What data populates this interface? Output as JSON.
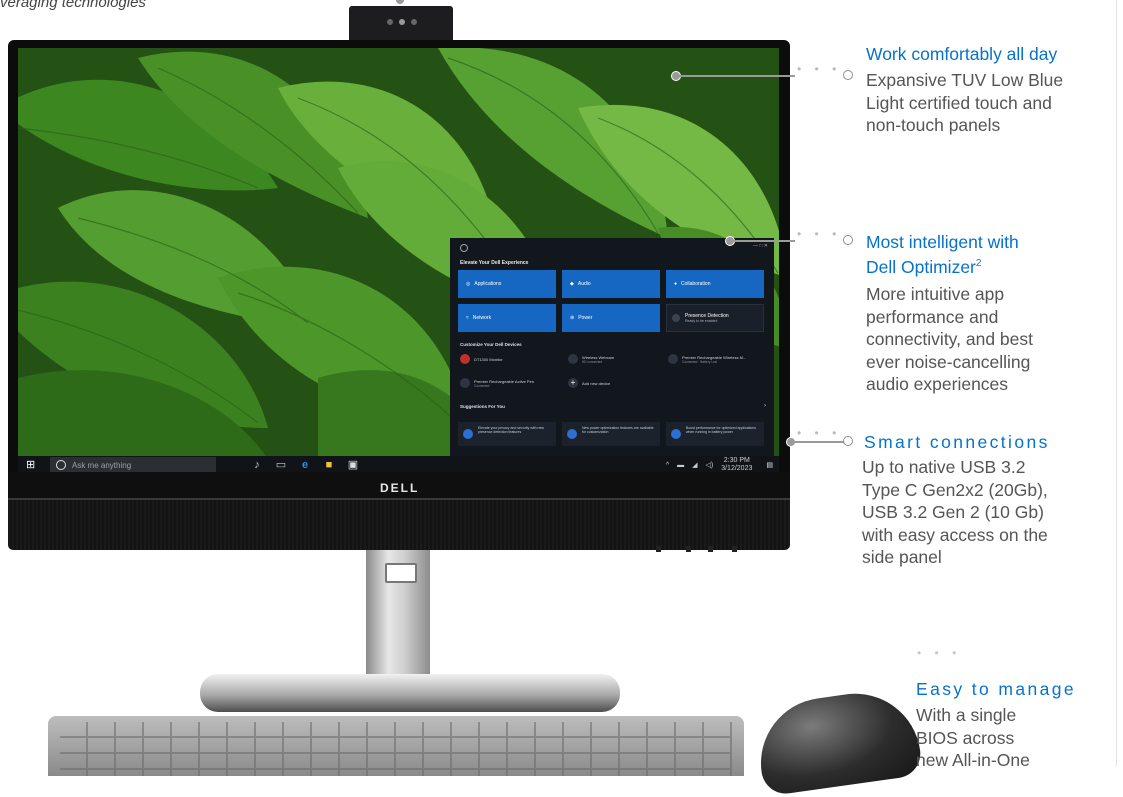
{
  "page": {
    "top_caption": "veraging technologies"
  },
  "device": {
    "brand_logo": "DELL",
    "taskbar": {
      "search_placeholder": "Ask me anything",
      "clock_time": "2:30 PM",
      "clock_date": "3/12/2023"
    },
    "optimizer_window": {
      "header": "Elevate Your Dell Experience",
      "tiles": [
        {
          "label": "Applications",
          "icon": "apps-icon"
        },
        {
          "label": "Audio",
          "icon": "audio-icon"
        },
        {
          "label": "Collaboration",
          "icon": "collab-icon"
        },
        {
          "label": "Network",
          "icon": "wifi-icon"
        },
        {
          "label": "Power",
          "icon": "power-icon"
        },
        {
          "label": "Presence Detection",
          "sub": "Ready to be enabled",
          "icon": "presence-icon"
        }
      ],
      "devices_header": "Customize Your Dell Devices",
      "devices": [
        {
          "name": "DT1300 Monitor"
        },
        {
          "name": "Wireless Webcam",
          "sub": "HD connected"
        },
        {
          "name": "Premier Rechargeable Wireless M...",
          "sub": "Connected · Battery Low"
        },
        {
          "name": "Premier Rechargeable Active Pen",
          "sub": "Connected"
        },
        {
          "name": "Add new device"
        }
      ],
      "suggestions_header": "Suggestions For You",
      "suggestions": [
        {
          "text": "Elevate your privacy and security with new presence detection features"
        },
        {
          "text": "New power optimization features are available for customization"
        },
        {
          "text": "Boost performance for optimized applications when running in battery power"
        }
      ]
    }
  },
  "callouts": [
    {
      "title": "Work comfortably all day",
      "body": [
        "Expansive TUV Low Blue",
        "Light certified touch and",
        "non-touch panels"
      ]
    },
    {
      "title_lines": [
        "Most intelligent with",
        "Dell Optimizer"
      ],
      "superscript": "2",
      "body": [
        "More intuitive app",
        "performance and",
        "connectivity, and best",
        "ever noise-cancelling",
        "audio experiences"
      ]
    },
    {
      "title": "Smart connections",
      "body": [
        "Up to native USB 3.2",
        "Type C Gen2x2 (20Gb),",
        "USB 3.2 Gen 2 (10 Gb)",
        "with easy access on the",
        "side panel"
      ]
    },
    {
      "title": "Easy to manage",
      "body": [
        "With a single",
        "BIOS across",
        "new All-in-One"
      ]
    }
  ],
  "colors": {
    "accent": "#0672cb",
    "body_text": "#555555",
    "tile_blue": "#1667c1"
  }
}
